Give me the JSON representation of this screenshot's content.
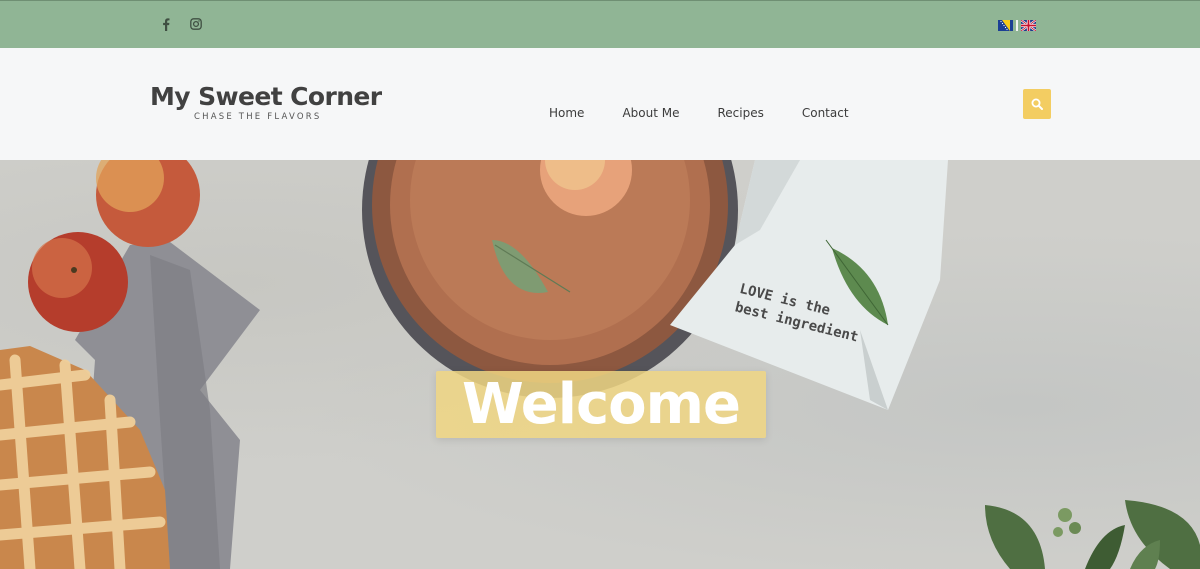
{
  "topbar": {
    "social": [
      {
        "name": "facebook-icon",
        "glyph": "f"
      },
      {
        "name": "instagram-icon"
      }
    ],
    "languages": [
      "bosnian-flag-icon",
      "uk-flag-icon"
    ],
    "colors": {
      "background": "#90b595"
    }
  },
  "header": {
    "logo_title": "My Sweet Corner",
    "logo_tagline": "CHASE THE FLAVORS",
    "nav": [
      "Home",
      "About Me",
      "Recipes",
      "Contact"
    ],
    "search_icon": "search-icon",
    "colors": {
      "accent": "#f3cd62"
    }
  },
  "hero": {
    "heading": "Welcome",
    "towel_text_line1": "LOVE is the",
    "towel_text_line2": "best ingredient"
  }
}
